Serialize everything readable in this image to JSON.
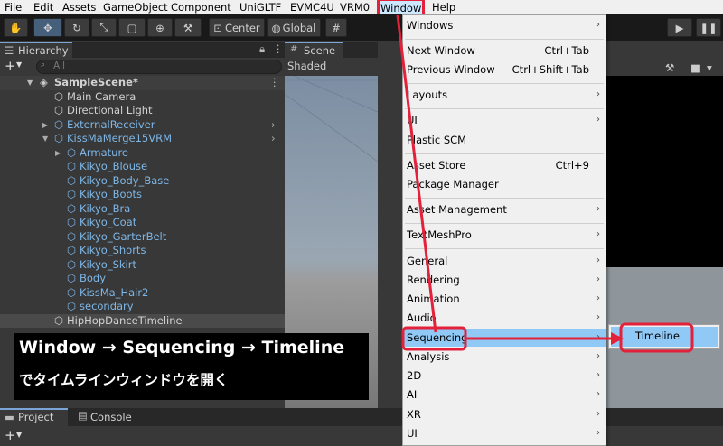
{
  "menubar": {
    "items": [
      "File",
      "Edit",
      "Assets",
      "GameObject",
      "Component",
      "UniGLTF",
      "EVMC4U",
      "VRM0",
      "Window",
      "Help"
    ]
  },
  "toolbar": {
    "center_label": "Center",
    "global_label": "Global"
  },
  "hierarchy": {
    "tab_label": "Hierarchy",
    "search_placeholder": "All",
    "scene_name": "SampleScene*",
    "items": [
      {
        "label": "Main Camera"
      },
      {
        "label": "Directional Light"
      },
      {
        "label": "ExternalReceiver"
      },
      {
        "label": "KissMaMerge15VRM"
      },
      {
        "label": "Armature"
      },
      {
        "label": "Kikyo_Blouse"
      },
      {
        "label": "Kikyo_Body_Base"
      },
      {
        "label": "Kikyo_Boots"
      },
      {
        "label": "Kikyo_Bra"
      },
      {
        "label": "Kikyo_Coat"
      },
      {
        "label": "Kikyo_GarterBelt"
      },
      {
        "label": "Kikyo_Shorts"
      },
      {
        "label": "Kikyo_Skirt"
      },
      {
        "label": "Body"
      },
      {
        "label": "KissMa_Hair2"
      },
      {
        "label": "secondary"
      },
      {
        "label": "HipHopDanceTimeline"
      }
    ]
  },
  "scene": {
    "tab_label": "Scene",
    "shading_mode": "Shaded"
  },
  "bottom": {
    "tab_project": "Project",
    "tab_console": "Console"
  },
  "window_menu": {
    "items": [
      {
        "label": "Windows",
        "shortcut": ""
      },
      {
        "label": "Next Window",
        "shortcut": "Ctrl+Tab"
      },
      {
        "label": "Previous Window",
        "shortcut": "Ctrl+Shift+Tab"
      },
      {
        "label": "Layouts",
        "shortcut": ""
      },
      {
        "label": "UI",
        "shortcut": ""
      },
      {
        "label": "Plastic SCM",
        "shortcut": ""
      },
      {
        "label": "Asset Store",
        "shortcut": "Ctrl+9"
      },
      {
        "label": "Package Manager",
        "shortcut": ""
      },
      {
        "label": "Asset Management",
        "shortcut": ""
      },
      {
        "label": "TextMeshPro",
        "shortcut": ""
      },
      {
        "label": "General",
        "shortcut": ""
      },
      {
        "label": "Rendering",
        "shortcut": ""
      },
      {
        "label": "Animation",
        "shortcut": ""
      },
      {
        "label": "Audio",
        "shortcut": ""
      },
      {
        "label": "Sequencing",
        "shortcut": ""
      },
      {
        "label": "Analysis",
        "shortcut": ""
      },
      {
        "label": "2D",
        "shortcut": ""
      },
      {
        "label": "AI",
        "shortcut": ""
      },
      {
        "label": "XR",
        "shortcut": ""
      },
      {
        "label": "UI",
        "shortcut": ""
      }
    ]
  },
  "submenu": {
    "item_label": "Timeline"
  },
  "caption": {
    "line1": "Window → Sequencing → Timeline",
    "line2": "でタイムラインウィンドウを開く"
  },
  "colors": {
    "annotation_red": "#e3213a",
    "highlight": "#90c8f6",
    "prefab_blue": "#7db7e8"
  }
}
